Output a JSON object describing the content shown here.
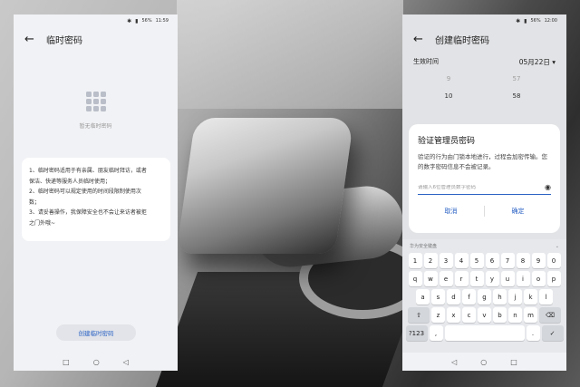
{
  "left": {
    "status": {
      "battery": "56%",
      "time": "11:59"
    },
    "title": "临时密码",
    "empty_text": "暂无临时密码",
    "info_lines": [
      "1、临时密码适用于有亲属、朋友临时拜访，或者",
      "保洁、快递等服务人员临时使用；",
      "2、临时密码可以规定使用的时间段限制使用次",
      "数；",
      "3、请妥善操作，我保障安全也不会让来访者被拒",
      "之门外哦~"
    ],
    "create_button": "创建临时密码"
  },
  "right": {
    "status": {
      "battery": "56%",
      "time": "12:00"
    },
    "title": "创建临时密码",
    "field_label": "生效时间",
    "field_value": "05月22日 ▾",
    "picker": {
      "col1": [
        "9",
        "10"
      ],
      "col2": [
        "57",
        "58"
      ]
    },
    "dialog": {
      "title": "验证管理员密码",
      "message": "验证的行为由门锁本地进行，过程会加密传输。您的数字密码信息不会被记录。",
      "placeholder": "请输入6位管理员数字密码",
      "cancel": "取消",
      "confirm": "确定"
    },
    "keyboard": {
      "brand": "华为安全键盘",
      "rows": [
        [
          "1",
          "2",
          "3",
          "4",
          "5",
          "6",
          "7",
          "8",
          "9",
          "0"
        ],
        [
          "q",
          "w",
          "e",
          "r",
          "t",
          "y",
          "u",
          "i",
          "o",
          "p"
        ],
        [
          "a",
          "s",
          "d",
          "f",
          "g",
          "h",
          "j",
          "k",
          "l"
        ],
        [
          "⇧",
          "z",
          "x",
          "c",
          "v",
          "b",
          "n",
          "m",
          "⌫"
        ]
      ],
      "sym_key": "?123",
      "comma_key": ",",
      "period_key": ".",
      "ok_key": "✓"
    }
  },
  "icons": {
    "back": "←",
    "nav_back": "◁",
    "nav_home": "○",
    "nav_recent": "□",
    "eye": "◉"
  }
}
